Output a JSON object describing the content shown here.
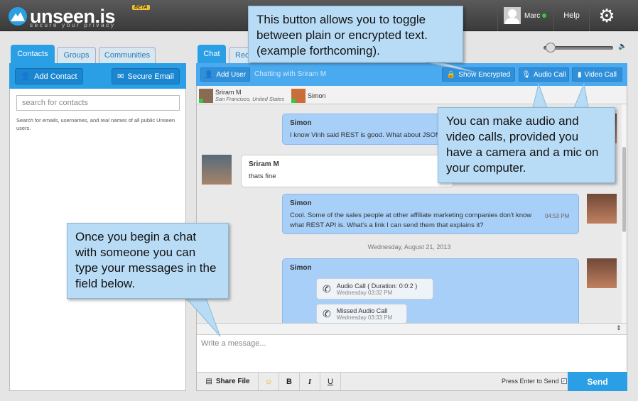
{
  "header": {
    "logo": "unseen.is",
    "tagline": "secure your privacy",
    "beta": "BETA",
    "user": "Marc",
    "help": "Help"
  },
  "left": {
    "tabs": [
      "Contacts",
      "Groups",
      "Communities"
    ],
    "add_contact": "Add Contact",
    "secure_email": "Secure Email",
    "search_placeholder": "search for contacts",
    "search_hint": "Search for emails, usernames, and real names of all public Unseen users."
  },
  "right": {
    "tabs": [
      "Chat",
      "Req"
    ],
    "add_user": "Add User",
    "chatting_with": "Chatting with Sriram M",
    "show_encrypted": "Show Encrypted",
    "audio_call": "Audio Call",
    "video_call": "Video Call",
    "participants": [
      {
        "name": "Sriram M",
        "location": "San Francisco, United States"
      },
      {
        "name": "Simon",
        "location": ""
      }
    ]
  },
  "messages": [
    {
      "name": "Simon",
      "text": "I know Vinh said REST is good. What about JSON?"
    },
    {
      "name": "Sriram M",
      "text": "thats fine"
    },
    {
      "name": "Simon",
      "text": "Cool. Some of the sales people at other affiliate marketing companies don't know what REST API is. What's a link I can send them that explains it?",
      "time": "04:53 PM"
    }
  ],
  "date_separator": "Wednesday, August 21, 2013",
  "calls_message": {
    "name": "Simon",
    "calls": [
      {
        "label": "Audio Call ( Duration: 0:0:2 )",
        "time": "Wednesday 03:32 PM"
      },
      {
        "label": "Missed Audio Call",
        "time": "Wednesday 03:33 PM"
      }
    ]
  },
  "composer": {
    "placeholder": "Write a message...",
    "share_file": "Share File",
    "bold": "B",
    "italic": "I",
    "underline": "U",
    "press_enter": "Press Enter to Send",
    "send": "Send"
  },
  "callouts": {
    "toggle": "This button allows you to toggle between plain or encrypted text. (example forthcoming).",
    "calls": "You can make audio and video calls, provided you have a camera and a mic on your computer.",
    "chat": "Once you begin a chat with someone you can type your messages in the field below."
  },
  "colors": {
    "accent": "#2a9fe6",
    "header": "#444444",
    "bubble_self": "#a7cff7",
    "callout": "#b9dcf6"
  }
}
